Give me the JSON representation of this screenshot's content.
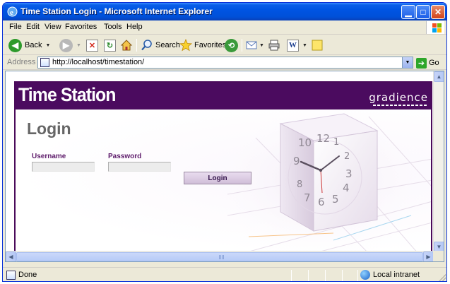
{
  "window": {
    "title": "Time Station Login - Microsoft Internet Explorer"
  },
  "menu": {
    "items": [
      "File",
      "Edit",
      "View",
      "Favorites",
      "Tools",
      "Help"
    ]
  },
  "toolbar": {
    "back_label": "Back",
    "search_label": "Search",
    "favorites_label": "Favorites"
  },
  "address": {
    "label": "Address",
    "url": "http://localhost/timestation/",
    "go_label": "Go"
  },
  "page": {
    "brand": "Time Station",
    "company": "gradience",
    "heading": "Login",
    "username_label": "Username",
    "password_label": "Password",
    "username_value": "",
    "password_value": "",
    "login_button": "Login",
    "clock_numbers": [
      "10",
      "12",
      "1",
      "9",
      "2",
      "3",
      "8",
      "4",
      "7",
      "6",
      "5"
    ]
  },
  "status": {
    "text": "Done",
    "zone": "Local intranet"
  },
  "colors": {
    "brand_purple": "#4b0b5f",
    "label_purple": "#5d1a6a",
    "titlebar_blue": "#0054e3"
  }
}
